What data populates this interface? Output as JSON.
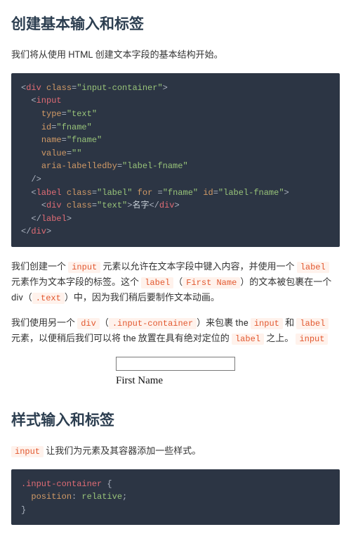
{
  "section1": {
    "heading": "创建基本输入和标签",
    "intro": "我们将从使用 HTML 创建文本字段的基本结构开始。"
  },
  "code1": {
    "l1": "<div class=\"input-container\">",
    "l2": "  <input",
    "l3": "    type=\"text\"",
    "l4": "    id=\"fname\"",
    "l5": "    name=\"fname\"",
    "l6": "    value=\"\"",
    "l7": "    aria-labelledby=\"label-fname\"",
    "l8": "  />",
    "l9": "  <label class=\"label\" for =\"fname\" id=\"label-fname\">",
    "l10": "    <div class=\"text\">名字</div>",
    "l11": "  </label>",
    "l12": "</div>"
  },
  "para1": {
    "t1": "我们创建一个 ",
    "c1": "input",
    "t2": " 元素以允许在文本字段中键入内容，并使用一个 ",
    "c2": "label",
    "t3": " 元素作为文本字段的标签。这个 ",
    "c3": "label",
    "t4": "（",
    "c4": "First Name",
    "t5": "）的文本被包裹在一个 div（",
    "c5": ".text",
    "t6": "）中，因为我们稍后要制作文本动画。"
  },
  "para2": {
    "t1": "我们使用另一个 ",
    "c1": "div",
    "t2": "（",
    "c2": ".input-container",
    "t3": "）来包裹 the ",
    "c3": "input",
    "t4": " 和 ",
    "c4": "label",
    "t5": " 元素，以便稍后我们可以将 the 放置在具有绝对定位的 ",
    "c5": "label",
    "t6": " 之上。 ",
    "c6": "input"
  },
  "demo": {
    "value": "",
    "label": "First Name"
  },
  "section2": {
    "heading": "样式输入和标签"
  },
  "para3": {
    "c1": "input",
    "t1": " 让我们为元素及其容器添加一些样式。"
  },
  "code2": {
    "l1": ".input-container {",
    "l2": "  position: relative;",
    "l3": "}"
  }
}
